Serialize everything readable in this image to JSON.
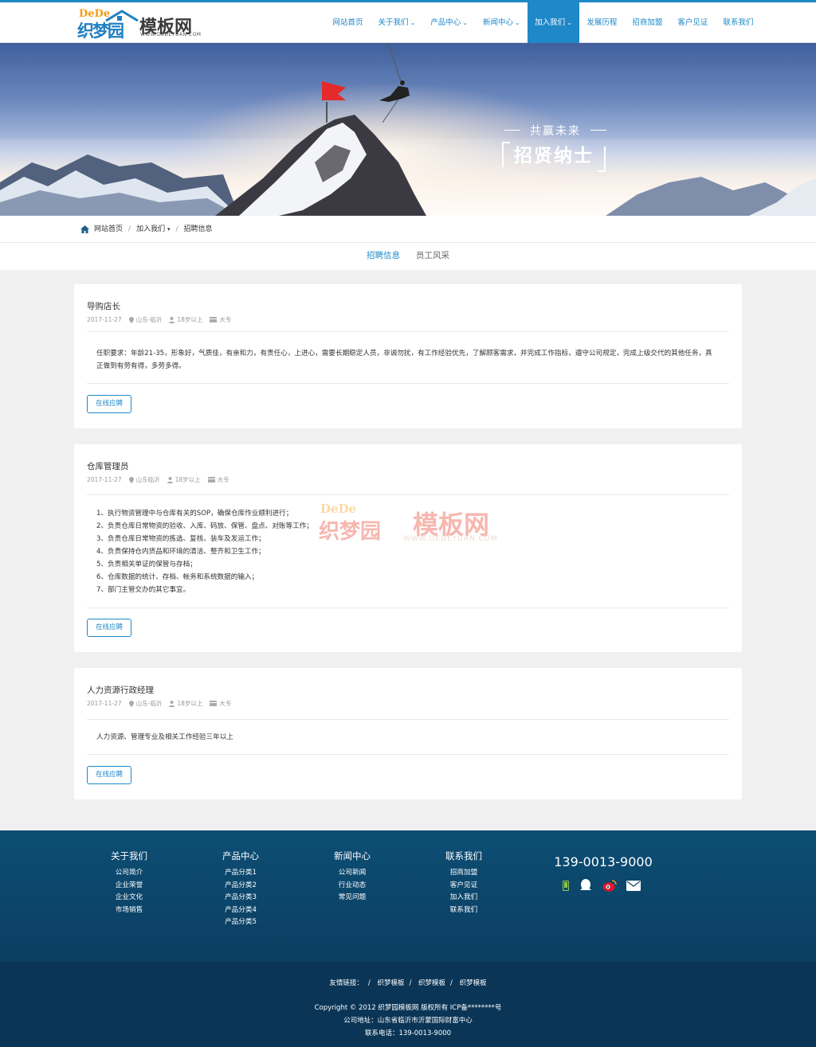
{
  "header": {
    "logo": {
      "dede": "DeDe",
      "name_part1": "织梦园",
      "name_part2": "模板网",
      "url": "WWW.DEDEYUAN.COM"
    },
    "nav": [
      {
        "label": "网站首页",
        "dropdown": false
      },
      {
        "label": "关于我们",
        "dropdown": true
      },
      {
        "label": "产品中心",
        "dropdown": true
      },
      {
        "label": "新闻中心",
        "dropdown": true
      },
      {
        "label": "加入我们",
        "dropdown": true,
        "active": true
      },
      {
        "label": "发展历程",
        "dropdown": false
      },
      {
        "label": "招商加盟",
        "dropdown": false
      },
      {
        "label": "客户见证",
        "dropdown": false
      },
      {
        "label": "联系我们",
        "dropdown": false
      }
    ],
    "accent_color": "#1e88c8"
  },
  "banner": {
    "slogan_small": "共赢未来",
    "slogan_big": "招贤纳士"
  },
  "breadcrumb": {
    "home": "网站首页",
    "parent": "加入我们",
    "current": "招聘信息",
    "separator": "/"
  },
  "subnav": {
    "items": [
      "招聘信息",
      "员工风采"
    ],
    "active_index": 0
  },
  "jobs": [
    {
      "title": "导购店长",
      "date": "2017-11-27",
      "location": "山东-临沂",
      "age": "18岁以上",
      "education": "大专",
      "body": "任职要求：年龄21-35，形象好，气质佳，有亲和力，有责任心，上进心，需要长期稳定人员，非诚勿扰，有工作经验优先，了解顾客需求，并完成工作指标，遵守公司规定，完成上级交代的其他任务，真正做到有劳有得，多劳多得。",
      "apply": "在线应聘"
    },
    {
      "title": "仓库管理员",
      "date": "2017-11-27",
      "location": "山东临沂",
      "age": "18岁以上",
      "education": "大专",
      "lines": [
        "1、执行物资管理中与仓库有关的SOP，确保仓库作业顺利进行；",
        "2、负责仓库日常物资的验收、入库、码放、保管、盘点、对账等工作；",
        "3、负责仓库日常物资的拣选、复核、装车及发运工作；",
        "4、负责保持仓内货品和环境的清洁、整齐和卫生工作；",
        "5、负责相关单证的保管与存档；",
        "6、仓库数据的统计、存档、帐务和系统数据的输入；",
        "7、部门主管交办的其它事宜。"
      ],
      "apply": "在线应聘"
    },
    {
      "title": "人力资源行政经理",
      "date": "2017-11-27",
      "location": "山东-临沂",
      "age": "18岁以上",
      "education": "大专",
      "body": "人力资源、管理专业及相关工作经验三年以上",
      "apply": "在线应聘"
    }
  ],
  "watermark": {
    "dede": "DeDe",
    "name_part1": "织梦园",
    "name_part2": "模板网",
    "url": "WWW.DEDEYUAN.COM"
  },
  "footer": {
    "columns": [
      {
        "title": "关于我们",
        "links": [
          "公司简介",
          "企业荣誉",
          "企业文化",
          "市场销售"
        ]
      },
      {
        "title": "产品中心",
        "links": [
          "产品分类1",
          "产品分类2",
          "产品分类3",
          "产品分类4",
          "产品分类5"
        ]
      },
      {
        "title": "新闻中心",
        "links": [
          "公司新闻",
          "行业动态",
          "常见问题"
        ]
      },
      {
        "title": "联系我们",
        "links": [
          "招商加盟",
          "客户见证",
          "加入我们",
          "联系我们"
        ]
      }
    ],
    "phone": "139-0013-9000",
    "social_icons": [
      "mobile-icon",
      "qq-icon",
      "weibo-icon",
      "mail-icon"
    ],
    "friend_links_label": "友情链接：",
    "friend_links": [
      "织梦模板",
      "织梦模板",
      "织梦模板"
    ],
    "copyright": "Copyright © 2012 织梦园模板网 版权所有 ICP备********号",
    "address": "公司地址：山东省临沂市沂蒙国际财富中心",
    "tel": "联系电话：139-0013-9000"
  }
}
